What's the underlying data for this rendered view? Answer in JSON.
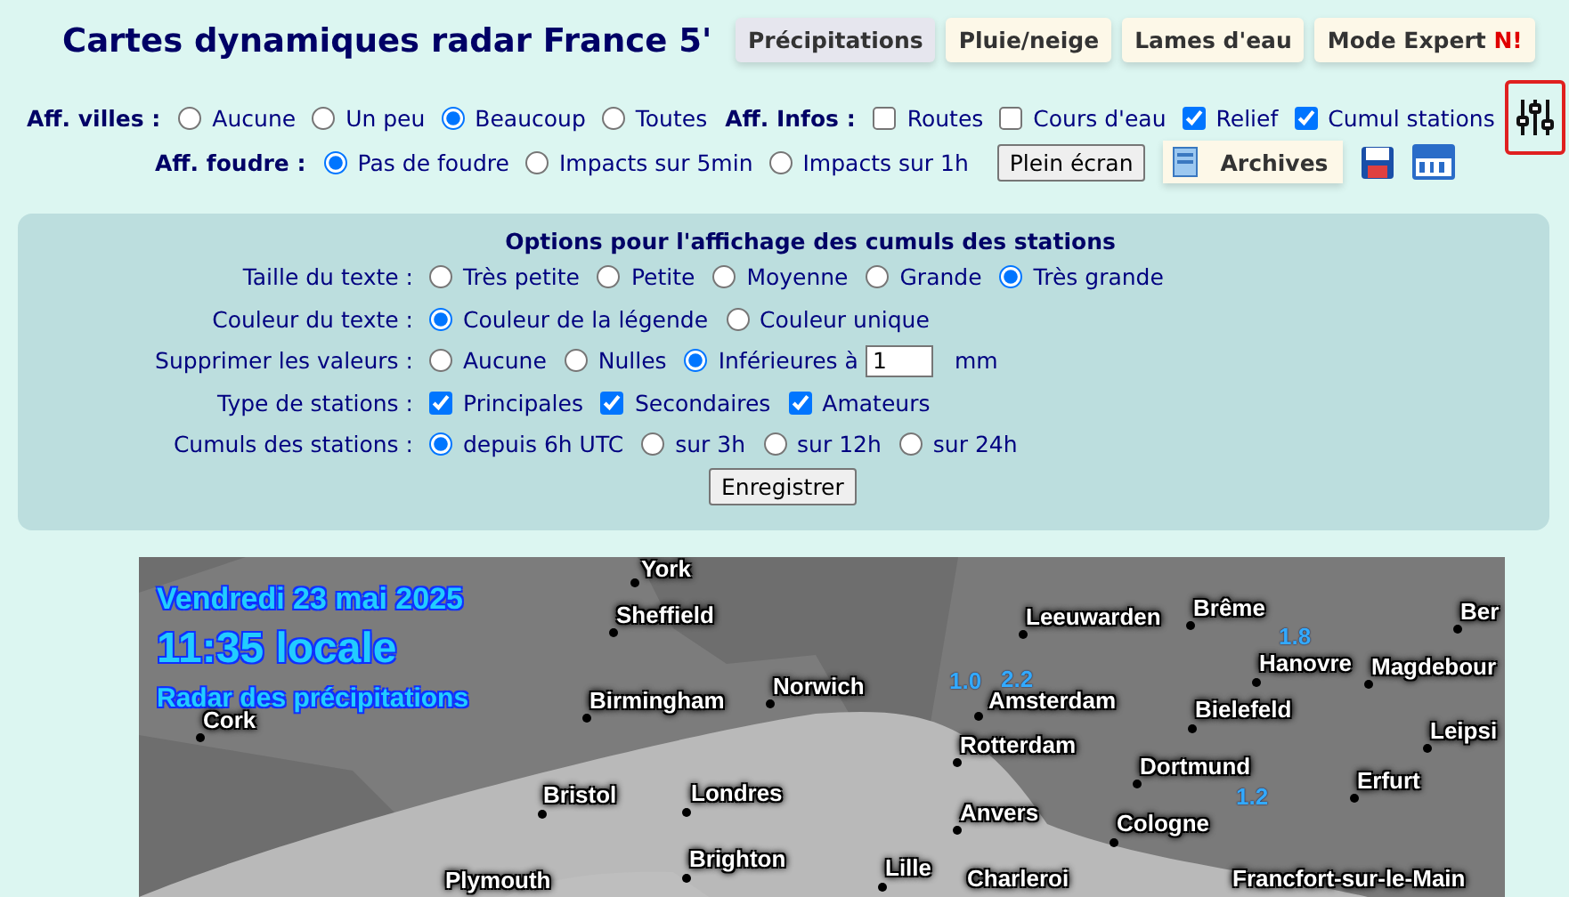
{
  "title": "Cartes dynamiques radar France 5'",
  "modes": [
    {
      "label": "Précipitations",
      "selected": true
    },
    {
      "label": "Pluie/neige",
      "selected": false
    },
    {
      "label": "Lames d'eau",
      "selected": false
    },
    {
      "label": "Mode Expert",
      "badge": "N!",
      "selected": false
    }
  ],
  "villes": {
    "label": "Aff. villes :",
    "options": [
      {
        "label": "Aucune",
        "selected": false
      },
      {
        "label": "Un peu",
        "selected": false
      },
      {
        "label": "Beaucoup",
        "selected": true
      },
      {
        "label": "Toutes",
        "selected": false
      }
    ]
  },
  "infos": {
    "label": "Aff. Infos :",
    "options": [
      {
        "label": "Routes",
        "checked": false
      },
      {
        "label": "Cours d'eau",
        "checked": false
      },
      {
        "label": "Relief",
        "checked": true
      },
      {
        "label": "Cumul stations",
        "checked": true
      }
    ]
  },
  "foudre": {
    "label": "Aff. foudre :",
    "options": [
      {
        "label": "Pas de foudre",
        "selected": true
      },
      {
        "label": "Impacts sur 5min",
        "selected": false
      },
      {
        "label": "Impacts sur 1h",
        "selected": false
      }
    ]
  },
  "fullscreen_button": "Plein écran",
  "archives_button": "Archives",
  "options_panel": {
    "title": "Options pour l'affichage des cumuls des stations",
    "rows": [
      {
        "label": "Taille du texte :",
        "kind": "radio",
        "options": [
          {
            "label": "Très petite",
            "selected": false
          },
          {
            "label": "Petite",
            "selected": false
          },
          {
            "label": "Moyenne",
            "selected": false
          },
          {
            "label": "Grande",
            "selected": false
          },
          {
            "label": "Très grande",
            "selected": true
          }
        ]
      },
      {
        "label": "Couleur du texte :",
        "kind": "radio",
        "options": [
          {
            "label": "Couleur de la légende",
            "selected": true
          },
          {
            "label": "Couleur unique",
            "selected": false
          }
        ]
      },
      {
        "label": "Supprimer les valeurs :",
        "kind": "radio",
        "options": [
          {
            "label": "Aucune",
            "selected": false
          },
          {
            "label": "Nulles",
            "selected": false
          },
          {
            "label": "Inférieures à",
            "selected": true,
            "value": "1",
            "unit": "mm"
          }
        ]
      },
      {
        "label": "Type de stations :",
        "kind": "checkbox",
        "options": [
          {
            "label": "Principales",
            "checked": true
          },
          {
            "label": "Secondaires",
            "checked": true
          },
          {
            "label": "Amateurs",
            "checked": true
          }
        ]
      },
      {
        "label": "Cumuls des stations :",
        "kind": "radio",
        "options": [
          {
            "label": "depuis 6h UTC",
            "selected": true
          },
          {
            "label": "sur 3h",
            "selected": false
          },
          {
            "label": "sur 12h",
            "selected": false
          },
          {
            "label": "sur 24h",
            "selected": false
          }
        ]
      }
    ],
    "save_button": "Enregistrer"
  },
  "map": {
    "date": "Vendredi 23 mai 2025",
    "time": "11:35 locale",
    "subtitle": "Radar des précipitations",
    "cities": [
      "York",
      "Sheffield",
      "Birmingham",
      "Norwich",
      "Cork",
      "Bristol",
      "Londres",
      "Brighton",
      "Plymouth",
      "Leeuwarden",
      "Brême",
      "Ber",
      "Hanovre",
      "Magdebour",
      "Amsterdam",
      "Bielefeld",
      "Leipsi",
      "Rotterdam",
      "Dortmund",
      "Erfurt",
      "Anvers",
      "Cologne",
      "Lille",
      "Charleroi",
      "Francfort-sur-le-Main"
    ],
    "station_values": [
      "1.0",
      "2.2",
      "1.8",
      "1.2"
    ]
  }
}
